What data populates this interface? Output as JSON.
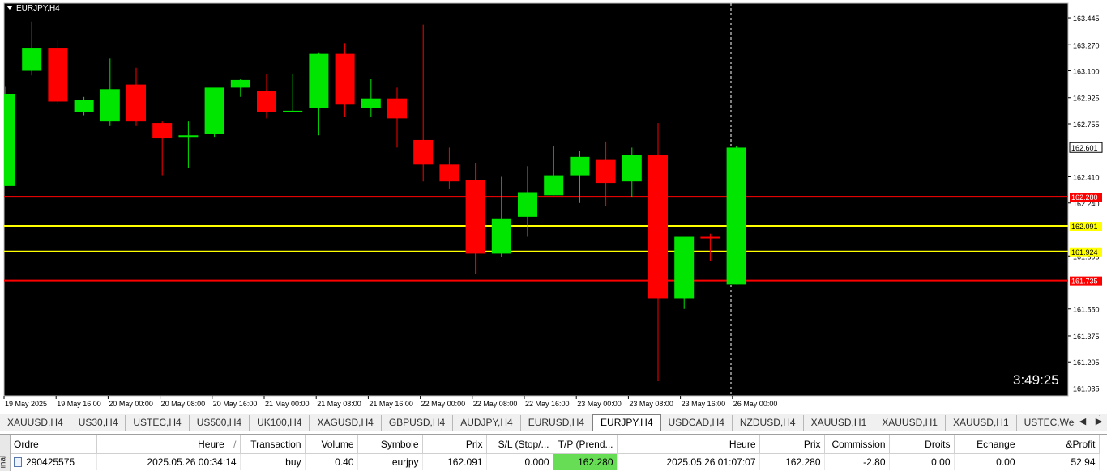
{
  "chart": {
    "symbol": "EURJPY,H4",
    "countdown": "3:49:25",
    "background": "#000000",
    "bull_color": "#00e600",
    "bear_color": "#ff0000",
    "price_axis": {
      "ticks": [
        "163.445",
        "163.270",
        "163.100",
        "162.925",
        "162.755",
        "162.410",
        "162.240",
        "161.895",
        "161.550",
        "161.375",
        "161.205",
        "161.035"
      ]
    },
    "time_axis": {
      "labels": [
        "19 May 2025",
        "19 May 16:00",
        "20 May 00:00",
        "20 May 08:00",
        "20 May 16:00",
        "21 May 00:00",
        "21 May 08:00",
        "21 May 16:00",
        "22 May 00:00",
        "22 May 08:00",
        "22 May 16:00",
        "23 May 00:00",
        "23 May 08:00",
        "23 May 16:00",
        "26 May 00:00"
      ]
    },
    "current_price": {
      "label": "162.601",
      "value": 162.601
    },
    "levels": [
      {
        "label": "162.280",
        "value": 162.28,
        "color": "#ff0000"
      },
      {
        "label": "162.091",
        "value": 162.091,
        "color": "#ffff00"
      },
      {
        "label": "161.924",
        "value": 161.924,
        "color": "#ffff00"
      },
      {
        "label": "161.735",
        "value": 161.735,
        "color": "#ff0000"
      }
    ],
    "chart_data": {
      "type": "candlestick",
      "candles": [
        {
          "o": 162.35,
          "h": 163.0,
          "l": 162.35,
          "c": 162.95
        },
        {
          "o": 163.1,
          "h": 163.42,
          "l": 163.07,
          "c": 163.25
        },
        {
          "o": 163.25,
          "h": 163.3,
          "l": 162.88,
          "c": 162.9
        },
        {
          "o": 162.83,
          "h": 162.93,
          "l": 162.81,
          "c": 162.91
        },
        {
          "o": 162.77,
          "h": 163.18,
          "l": 162.74,
          "c": 162.98
        },
        {
          "o": 163.01,
          "h": 163.12,
          "l": 162.74,
          "c": 162.77
        },
        {
          "o": 162.76,
          "h": 162.77,
          "l": 162.42,
          "c": 162.66
        },
        {
          "o": 162.67,
          "h": 162.77,
          "l": 162.47,
          "c": 162.68
        },
        {
          "o": 162.69,
          "h": 162.96,
          "l": 162.67,
          "c": 162.99
        },
        {
          "o": 162.99,
          "h": 163.05,
          "l": 162.93,
          "c": 163.04
        },
        {
          "o": 162.97,
          "h": 163.08,
          "l": 162.79,
          "c": 162.83
        },
        {
          "o": 162.84,
          "h": 163.08,
          "l": 162.83,
          "c": 162.84
        },
        {
          "o": 162.86,
          "h": 163.22,
          "l": 162.68,
          "c": 163.21
        },
        {
          "o": 163.21,
          "h": 163.28,
          "l": 162.8,
          "c": 162.88
        },
        {
          "o": 162.86,
          "h": 163.05,
          "l": 162.8,
          "c": 162.92
        },
        {
          "o": 162.92,
          "h": 162.99,
          "l": 162.6,
          "c": 162.79
        },
        {
          "o": 162.65,
          "h": 163.4,
          "l": 162.38,
          "c": 162.49
        },
        {
          "o": 162.49,
          "h": 162.6,
          "l": 162.33,
          "c": 162.38
        },
        {
          "o": 162.39,
          "h": 162.5,
          "l": 161.78,
          "c": 161.91
        },
        {
          "o": 161.91,
          "h": 162.41,
          "l": 161.89,
          "c": 162.14
        },
        {
          "o": 162.15,
          "h": 162.48,
          "l": 162.02,
          "c": 162.31
        },
        {
          "o": 162.29,
          "h": 162.61,
          "l": 162.29,
          "c": 162.42
        },
        {
          "o": 162.42,
          "h": 162.58,
          "l": 162.24,
          "c": 162.54
        },
        {
          "o": 162.52,
          "h": 162.64,
          "l": 162.22,
          "c": 162.37
        },
        {
          "o": 162.38,
          "h": 162.6,
          "l": 162.28,
          "c": 162.55
        },
        {
          "o": 162.55,
          "h": 162.76,
          "l": 161.08,
          "c": 161.62
        },
        {
          "o": 161.62,
          "h": 162.0,
          "l": 161.55,
          "c": 162.02
        },
        {
          "o": 162.02,
          "h": 162.04,
          "l": 161.86,
          "c": 162.01
        },
        {
          "o": 161.71,
          "h": 162.61,
          "l": 161.71,
          "c": 162.6
        }
      ]
    }
  },
  "tabs": [
    {
      "label": "XAUUSD,H4",
      "active": false
    },
    {
      "label": "US30,H4",
      "active": false
    },
    {
      "label": "USTEC,H4",
      "active": false
    },
    {
      "label": "US500,H4",
      "active": false
    },
    {
      "label": "UK100,H4",
      "active": false
    },
    {
      "label": "XAGUSD,H4",
      "active": false
    },
    {
      "label": "GBPUSD,H4",
      "active": false
    },
    {
      "label": "AUDJPY,H4",
      "active": false
    },
    {
      "label": "EURUSD,H4",
      "active": false
    },
    {
      "label": "EURJPY,H4",
      "active": true
    },
    {
      "label": "USDCAD,H4",
      "active": false
    },
    {
      "label": "NZDUSD,H4",
      "active": false
    },
    {
      "label": "XAUUSD,H1",
      "active": false
    },
    {
      "label": "XAUUSD,H1",
      "active": false
    },
    {
      "label": "XAUUSD,H1",
      "active": false
    },
    {
      "label": "USTEC,Weekly",
      "active": false
    }
  ],
  "tab_nav": {
    "left": "◀",
    "right": "▶"
  },
  "terminal": {
    "side_label": "inal",
    "columns": [
      "Ordre",
      "Heure",
      "Transaction",
      "Volume",
      "Symbole",
      "Prix",
      "S/L (Stop/...",
      "T/P (Prend...",
      "Heure",
      "Prix",
      "Commission",
      "Droits",
      "Echange",
      "&Profit"
    ],
    "sort_indicator": "/",
    "rows": [
      [
        "290425575",
        "2025.05.26 00:34:14",
        "buy",
        "0.40",
        "eurjpy",
        "162.091",
        "0.000",
        "162.280",
        "2025.05.26 01:07:07",
        "162.280",
        "-2.80",
        "0.00",
        "0.00",
        "52.94"
      ]
    ]
  }
}
